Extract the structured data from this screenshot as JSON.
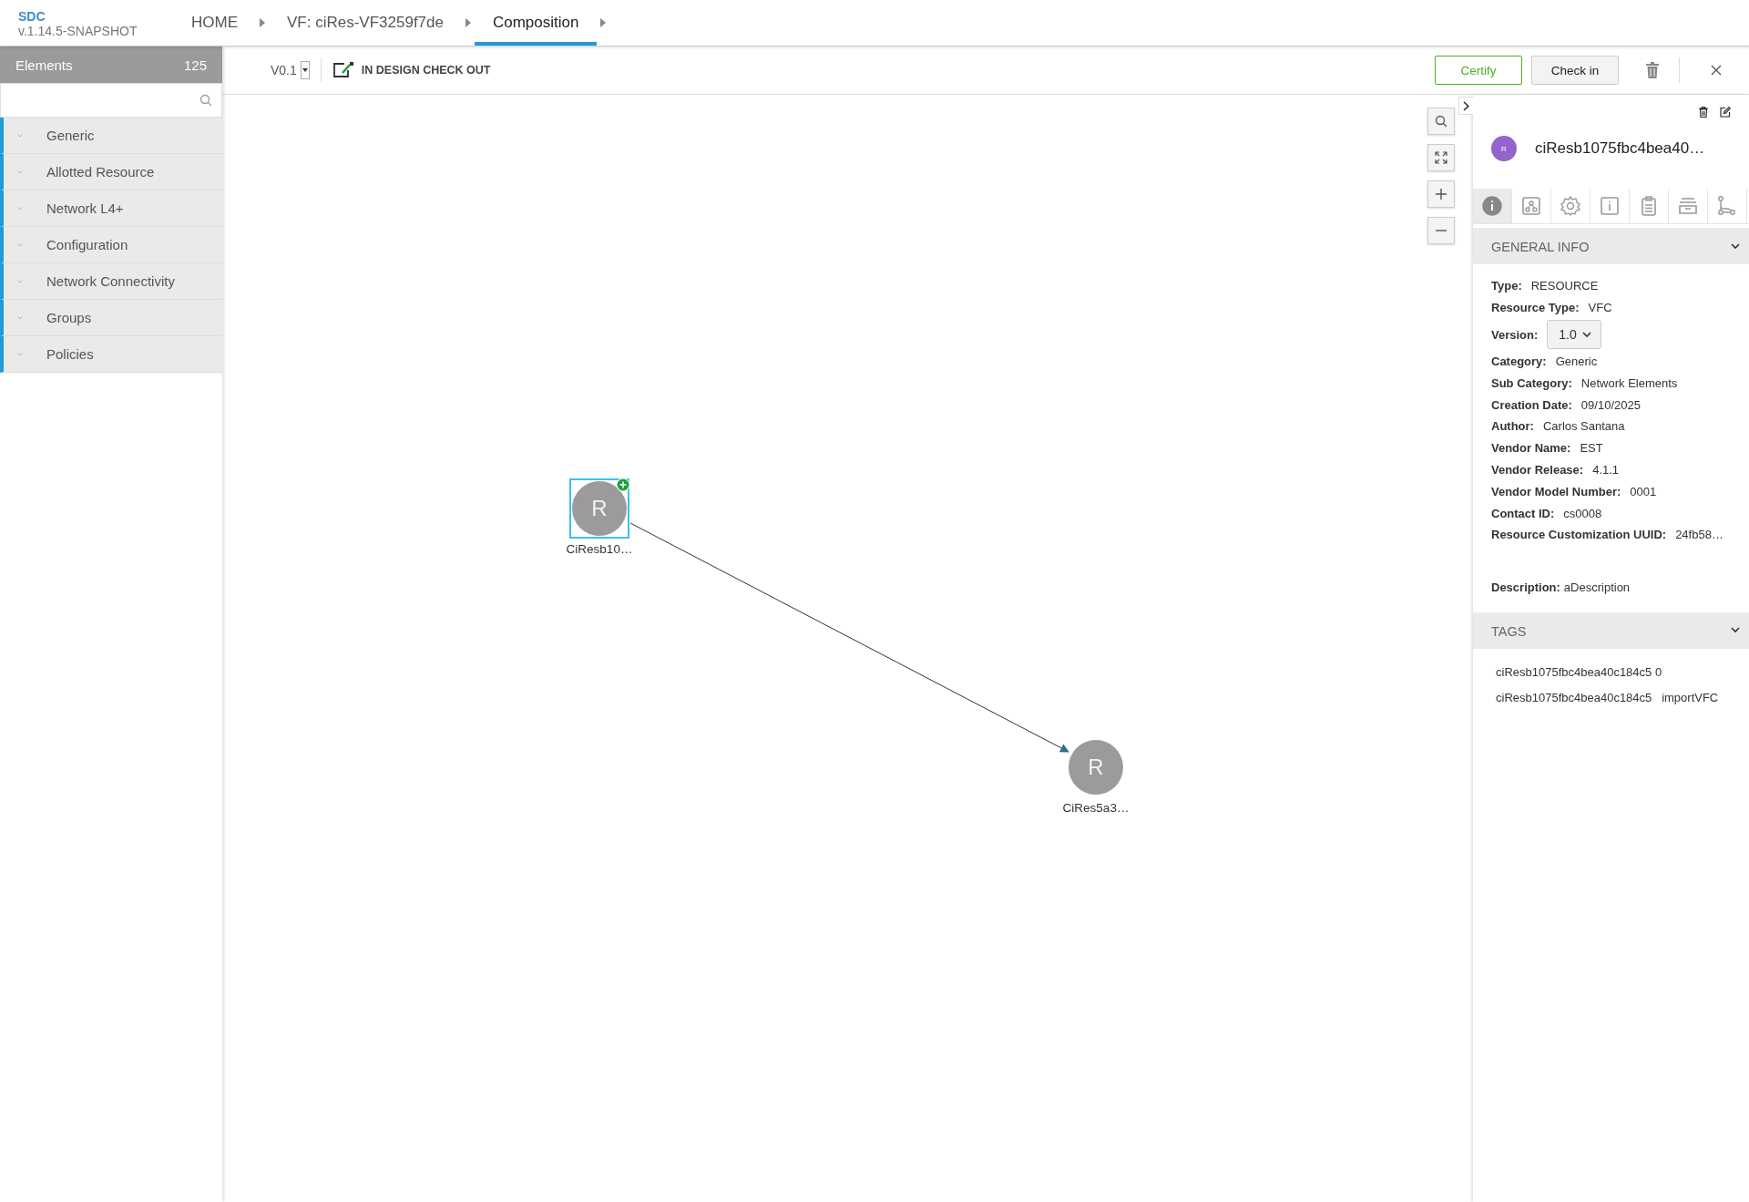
{
  "app": {
    "name": "SDC",
    "version": "v.1.14.5-SNAPSHOT"
  },
  "breadcrumbs": [
    {
      "label": "HOME",
      "selected": false
    },
    {
      "label": "VF: ciRes-VF3259f7de",
      "selected": false
    },
    {
      "label": "Composition",
      "selected": true
    }
  ],
  "palette": {
    "title": "Elements",
    "count": "125",
    "categories": [
      "Generic",
      "Allotted Resource",
      "Network L4+",
      "Configuration",
      "Network Connectivity",
      "Groups",
      "Policies"
    ]
  },
  "toolbar": {
    "version": "V0.1",
    "status": "IN DESIGN CHECK OUT",
    "buttons": [
      {
        "label": "Certify",
        "kind": "primary"
      },
      {
        "label": "Check in",
        "kind": "default"
      }
    ]
  },
  "canvas": {
    "nodes": [
      {
        "letter": "R",
        "label": "CiResb10…",
        "selected": true
      },
      {
        "letter": "R",
        "label": "CiRes5a3…",
        "selected": false
      }
    ]
  },
  "details": {
    "avatar": "R",
    "title": "ciResb1075fbc4bea40…",
    "tabs": [
      {
        "selected": true
      },
      {
        "selected": false
      },
      {
        "selected": false
      },
      {
        "selected": false
      },
      {
        "selected": false
      },
      {
        "selected": false
      },
      {
        "selected": false
      }
    ],
    "general_info": {
      "title": "GENERAL INFO",
      "expanded": true,
      "fields": [
        {
          "label": "Type:",
          "value": "RESOURCE",
          "kind": "text"
        },
        {
          "label": "Resource Type:",
          "value": "VFC",
          "kind": "text"
        },
        {
          "label": "Version:",
          "value": "1.0",
          "kind": "select"
        },
        {
          "label": "Category:",
          "value": "Generic",
          "kind": "text"
        },
        {
          "label": "Sub Category:",
          "value": "Network Elements",
          "kind": "text"
        },
        {
          "label": "Creation Date:",
          "value": "09/10/2025",
          "kind": "text"
        },
        {
          "label": "Author:",
          "value": "Carlos Santana",
          "kind": "text"
        },
        {
          "label": "Vendor Name:",
          "value": "EST",
          "kind": "text"
        },
        {
          "label": "Vendor Release:",
          "value": "4.1.1",
          "kind": "text"
        },
        {
          "label": "Vendor Model Number:",
          "value": "0001",
          "kind": "text"
        },
        {
          "label": "Contact ID:",
          "value": "cs0008",
          "kind": "text"
        },
        {
          "label": "Resource Customization UUID:",
          "value": "24fb58…",
          "kind": "text"
        }
      ],
      "description": {
        "label": "Description:",
        "value": "aDescription"
      }
    },
    "tags": {
      "title": "TAGS",
      "expanded": true,
      "items": [
        "ciResb1075fbc4bea40c184c5 0",
        "ciResb1075fbc4bea40c184c5   importVFC"
      ]
    }
  }
}
